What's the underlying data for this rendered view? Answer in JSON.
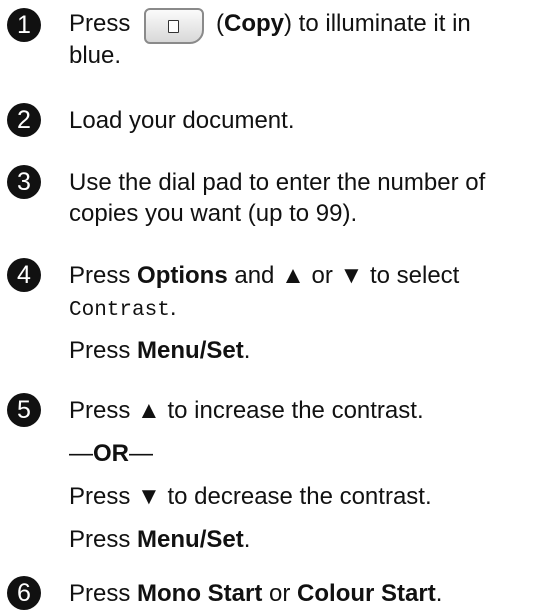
{
  "steps": [
    {
      "number": "1",
      "lines": [
        {
          "pre": "Press",
          "btn_label": "Copy",
          "post": "to illuminate it in"
        },
        {
          "text": "blue."
        }
      ]
    },
    {
      "number": "2",
      "text": "Load your document."
    },
    {
      "number": "3",
      "lines": [
        "Use the dial pad to enter the number of",
        "copies you want (up to 99)."
      ]
    },
    {
      "number": "4",
      "pre": "Press",
      "options": "Options",
      "mid": "and",
      "up": "▲",
      "or": "or",
      "down": "▼",
      "post": "to select",
      "menu_value": "Contrast",
      "period": ".",
      "press2": "Press",
      "menu_set": "Menu/Set",
      "period2": "."
    },
    {
      "number": "5",
      "press_up": "Press",
      "up": "▲",
      "inc": "to increase the contrast.",
      "or_label": "OR",
      "dash": "—",
      "press_down": "Press",
      "down": "▼",
      "dec": "to decrease the contrast.",
      "press3": "Press",
      "menu_set": "Menu/Set",
      "period": "."
    },
    {
      "number": "6",
      "pre": "Press",
      "mono": "Mono Start",
      "or": "or",
      "colour": "Colour Start",
      "period": "."
    }
  ],
  "icons": {
    "copy_button": "copy-button-icon"
  }
}
